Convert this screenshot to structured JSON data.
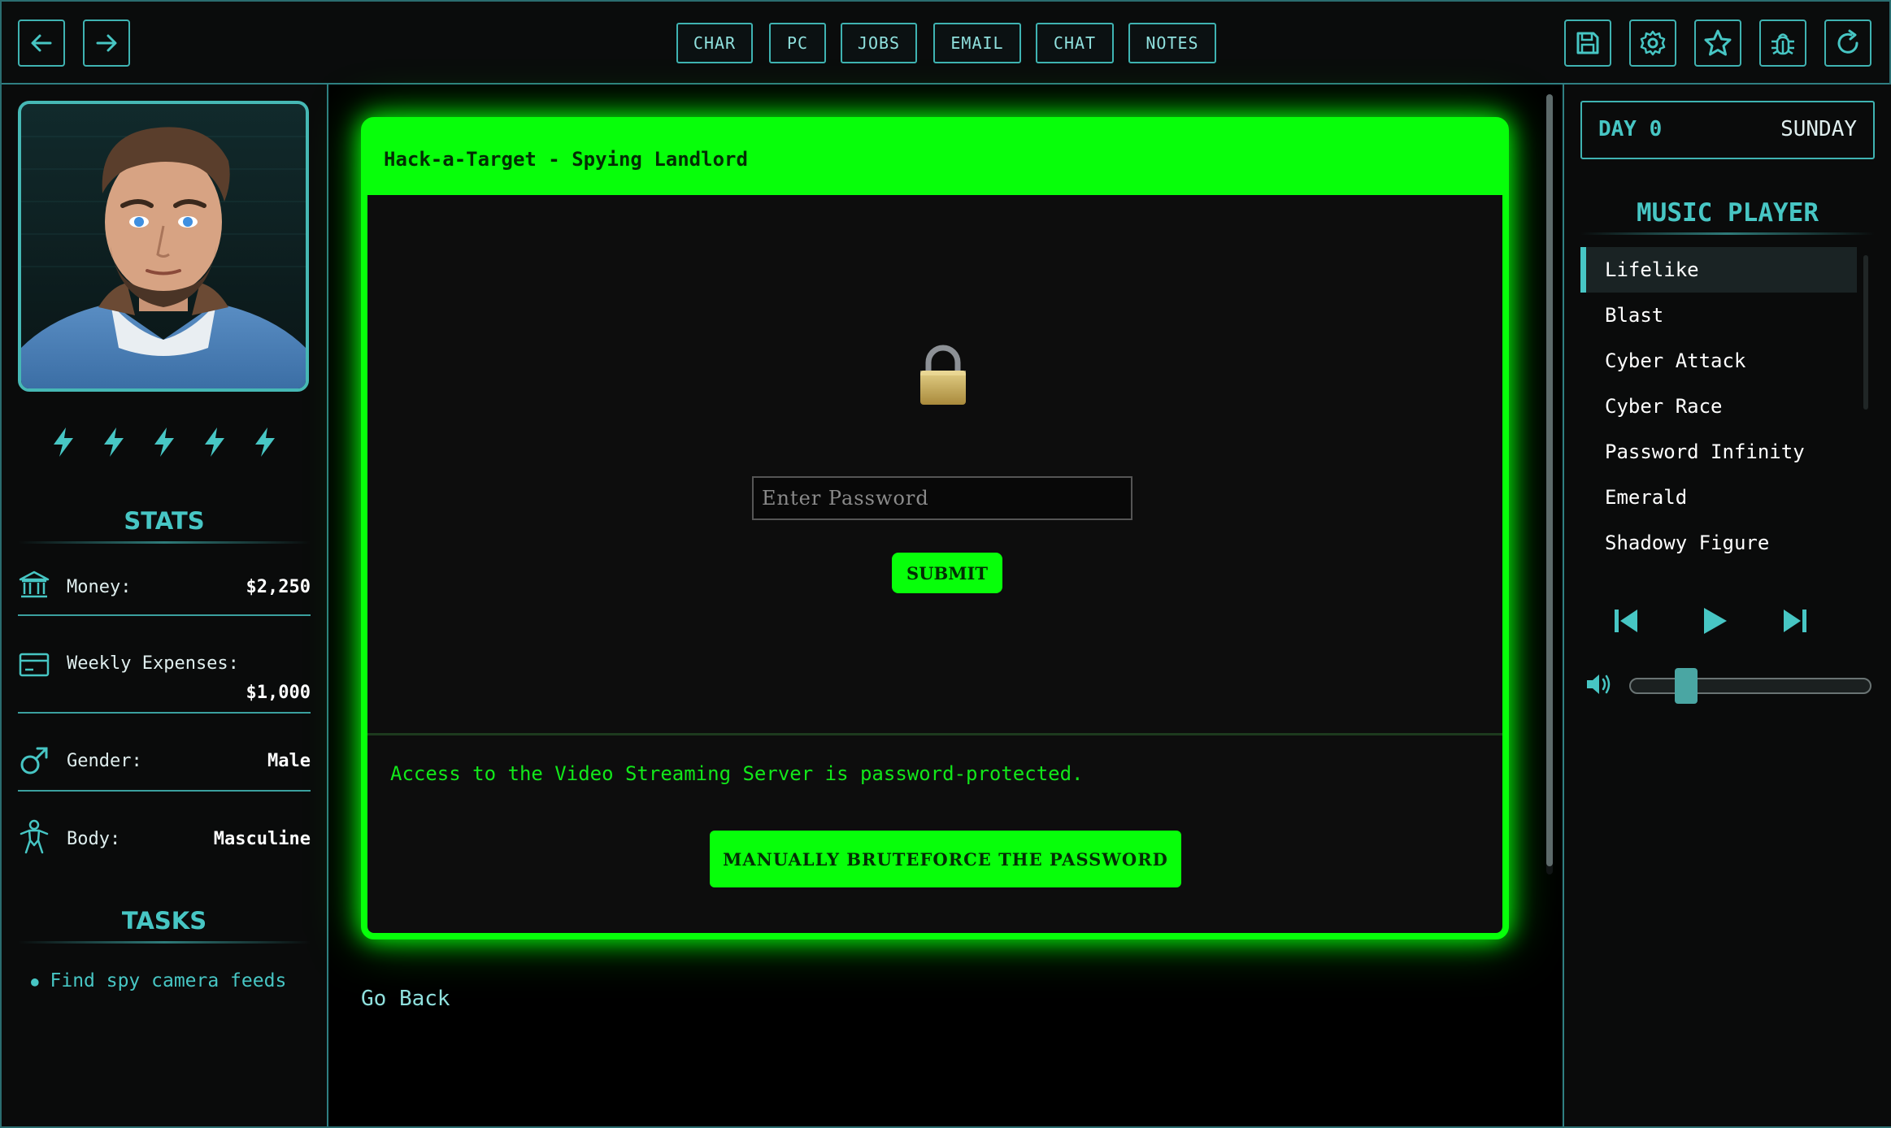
{
  "tabs": [
    "CHAR",
    "PC",
    "JOBS",
    "EMAIL",
    "CHAT",
    "NOTES"
  ],
  "sidebar": {
    "stats_title": "STATS",
    "money_label": "Money:",
    "money_value": "$2,250",
    "expenses_label": "Weekly Expenses:",
    "expenses_value": "$1,000",
    "gender_label": "Gender:",
    "gender_value": "Male",
    "body_label": "Body:",
    "body_value": "Masculine",
    "tasks_title": "TASKS",
    "tasks": [
      "Find spy camera feeds"
    ],
    "energy_bolts": 5
  },
  "hack": {
    "title": "Hack-a-Target - Spying Landlord",
    "password_placeholder": "Enter Password",
    "submit_label": "SUBMIT",
    "access_text": "Access to the Video Streaming Server is password-protected.",
    "bruteforce_label": "MANUALLY BRUTEFORCE THE PASSWORD",
    "go_back": "Go Back"
  },
  "right": {
    "day_label": "DAY 0",
    "day_name": "SUNDAY",
    "music_title": "MUSIC PLAYER",
    "songs": [
      "Lifelike",
      "Blast",
      "Cyber Attack",
      "Cyber Race",
      "Password Infinity",
      "Emerald",
      "Shadowy Figure"
    ],
    "active_song_index": 0,
    "volume": 0.2
  },
  "colors": {
    "accent": "#47c6c4",
    "neon_green": "#07ff0a",
    "background": "#050606"
  }
}
